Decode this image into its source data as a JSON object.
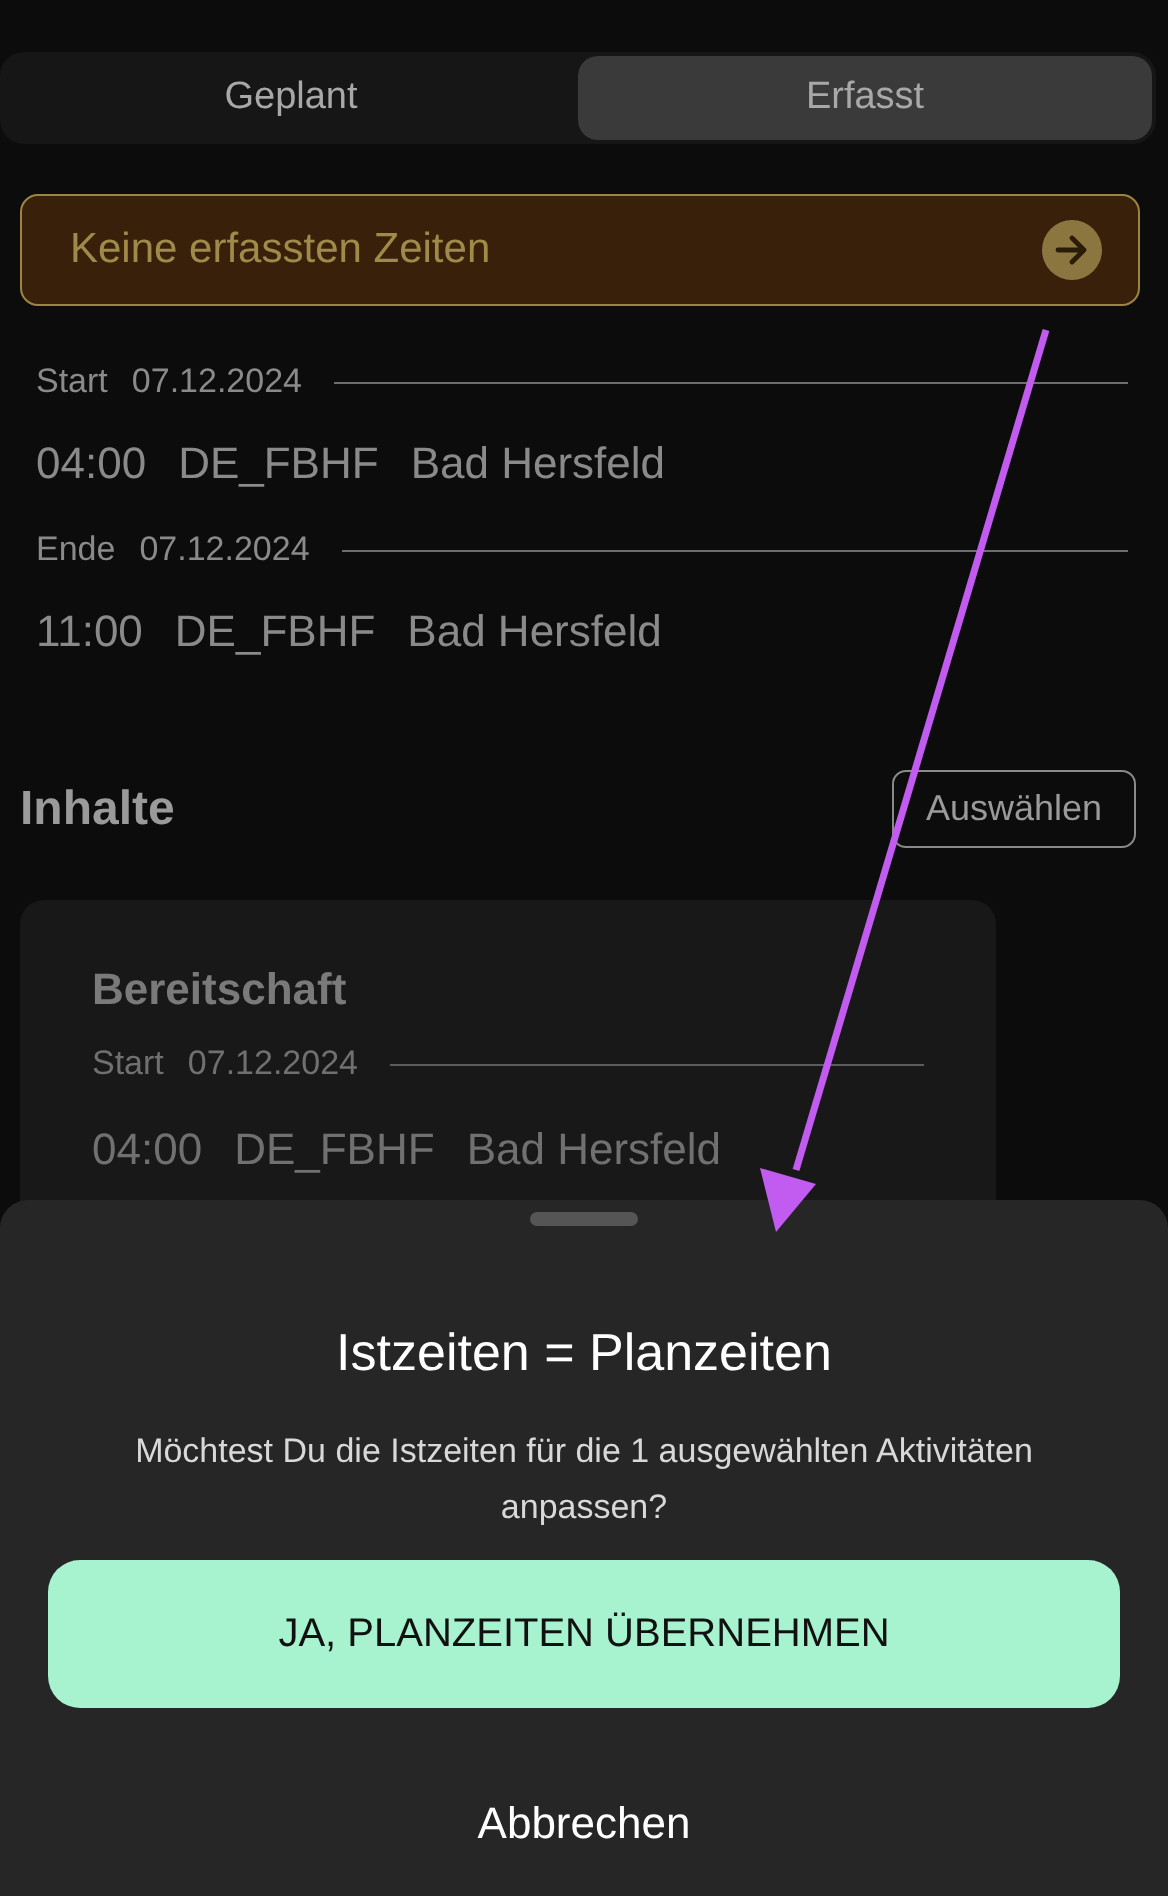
{
  "tabs": [
    {
      "label": "Geplant",
      "selected": false
    },
    {
      "label": "Erfasst",
      "selected": true
    }
  ],
  "banner": {
    "text": "Keine erfassten Zeiten"
  },
  "times": [
    {
      "label": "Start",
      "date": "07.12.2024",
      "time": "04:00",
      "code": "DE_FBHF",
      "place": "Bad Hersfeld"
    },
    {
      "label": "Ende",
      "date": "07.12.2024",
      "time": "11:00",
      "code": "DE_FBHF",
      "place": "Bad Hersfeld"
    }
  ],
  "contents": {
    "title": "Inhalte",
    "select_button": "Auswählen",
    "cards": [
      {
        "title": "Bereitschaft",
        "label": "Start",
        "date": "07.12.2024",
        "time": "04:00",
        "code": "DE_FBHF",
        "place": "Bad Hersfeld"
      }
    ]
  },
  "sheet": {
    "title": "Istzeiten = Planzeiten",
    "message": "Möchtest Du die Istzeiten für die 1 ausgewählten Aktivitäten anpassen?",
    "confirm": "JA, PLANZEITEN ÜBERNEHMEN",
    "cancel": "Abbrechen"
  }
}
